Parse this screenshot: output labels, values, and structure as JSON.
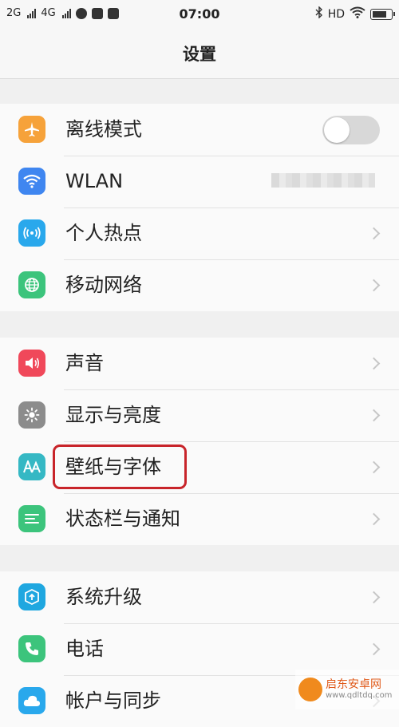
{
  "status_bar": {
    "net1": "2G",
    "net2": "4G",
    "time": "07:00",
    "hd": "HD",
    "battery_level": 0.85
  },
  "header": {
    "title": "设置"
  },
  "groups": [
    {
      "items": [
        {
          "label": "离线模式",
          "icon": "airplane-icon",
          "color": "#f6a23a",
          "control": "toggle",
          "toggle_on": false
        },
        {
          "label": "WLAN",
          "icon": "wifi-icon",
          "color": "#3f86f0",
          "control": "value"
        },
        {
          "label": "个人热点",
          "icon": "hotspot-icon",
          "color": "#29a8ec",
          "control": "chevron"
        },
        {
          "label": "移动网络",
          "icon": "globe-icon",
          "color": "#3cc47c",
          "control": "chevron"
        }
      ]
    },
    {
      "items": [
        {
          "label": "声音",
          "icon": "speaker-icon",
          "color": "#f0485a",
          "control": "chevron"
        },
        {
          "label": "显示与亮度",
          "icon": "brightness-icon",
          "color": "#8c8c8c",
          "control": "chevron"
        },
        {
          "label": "壁纸与字体",
          "icon": "font-icon",
          "color": "#35b8c4",
          "control": "chevron",
          "highlighted": true
        },
        {
          "label": "状态栏与通知",
          "icon": "list-icon",
          "color": "#3cc47c",
          "control": "chevron"
        }
      ]
    },
    {
      "items": [
        {
          "label": "系统升级",
          "icon": "upgrade-icon",
          "color": "#1fa7e0",
          "control": "chevron"
        },
        {
          "label": "电话",
          "icon": "phone-icon",
          "color": "#3cc47c",
          "control": "chevron"
        },
        {
          "label": "帐户与同步",
          "icon": "cloud-icon",
          "color": "#29a8ec",
          "control": "chevron"
        }
      ]
    }
  ],
  "watermark": {
    "name": "启东安卓网",
    "url": "www.qdltdq.com"
  }
}
